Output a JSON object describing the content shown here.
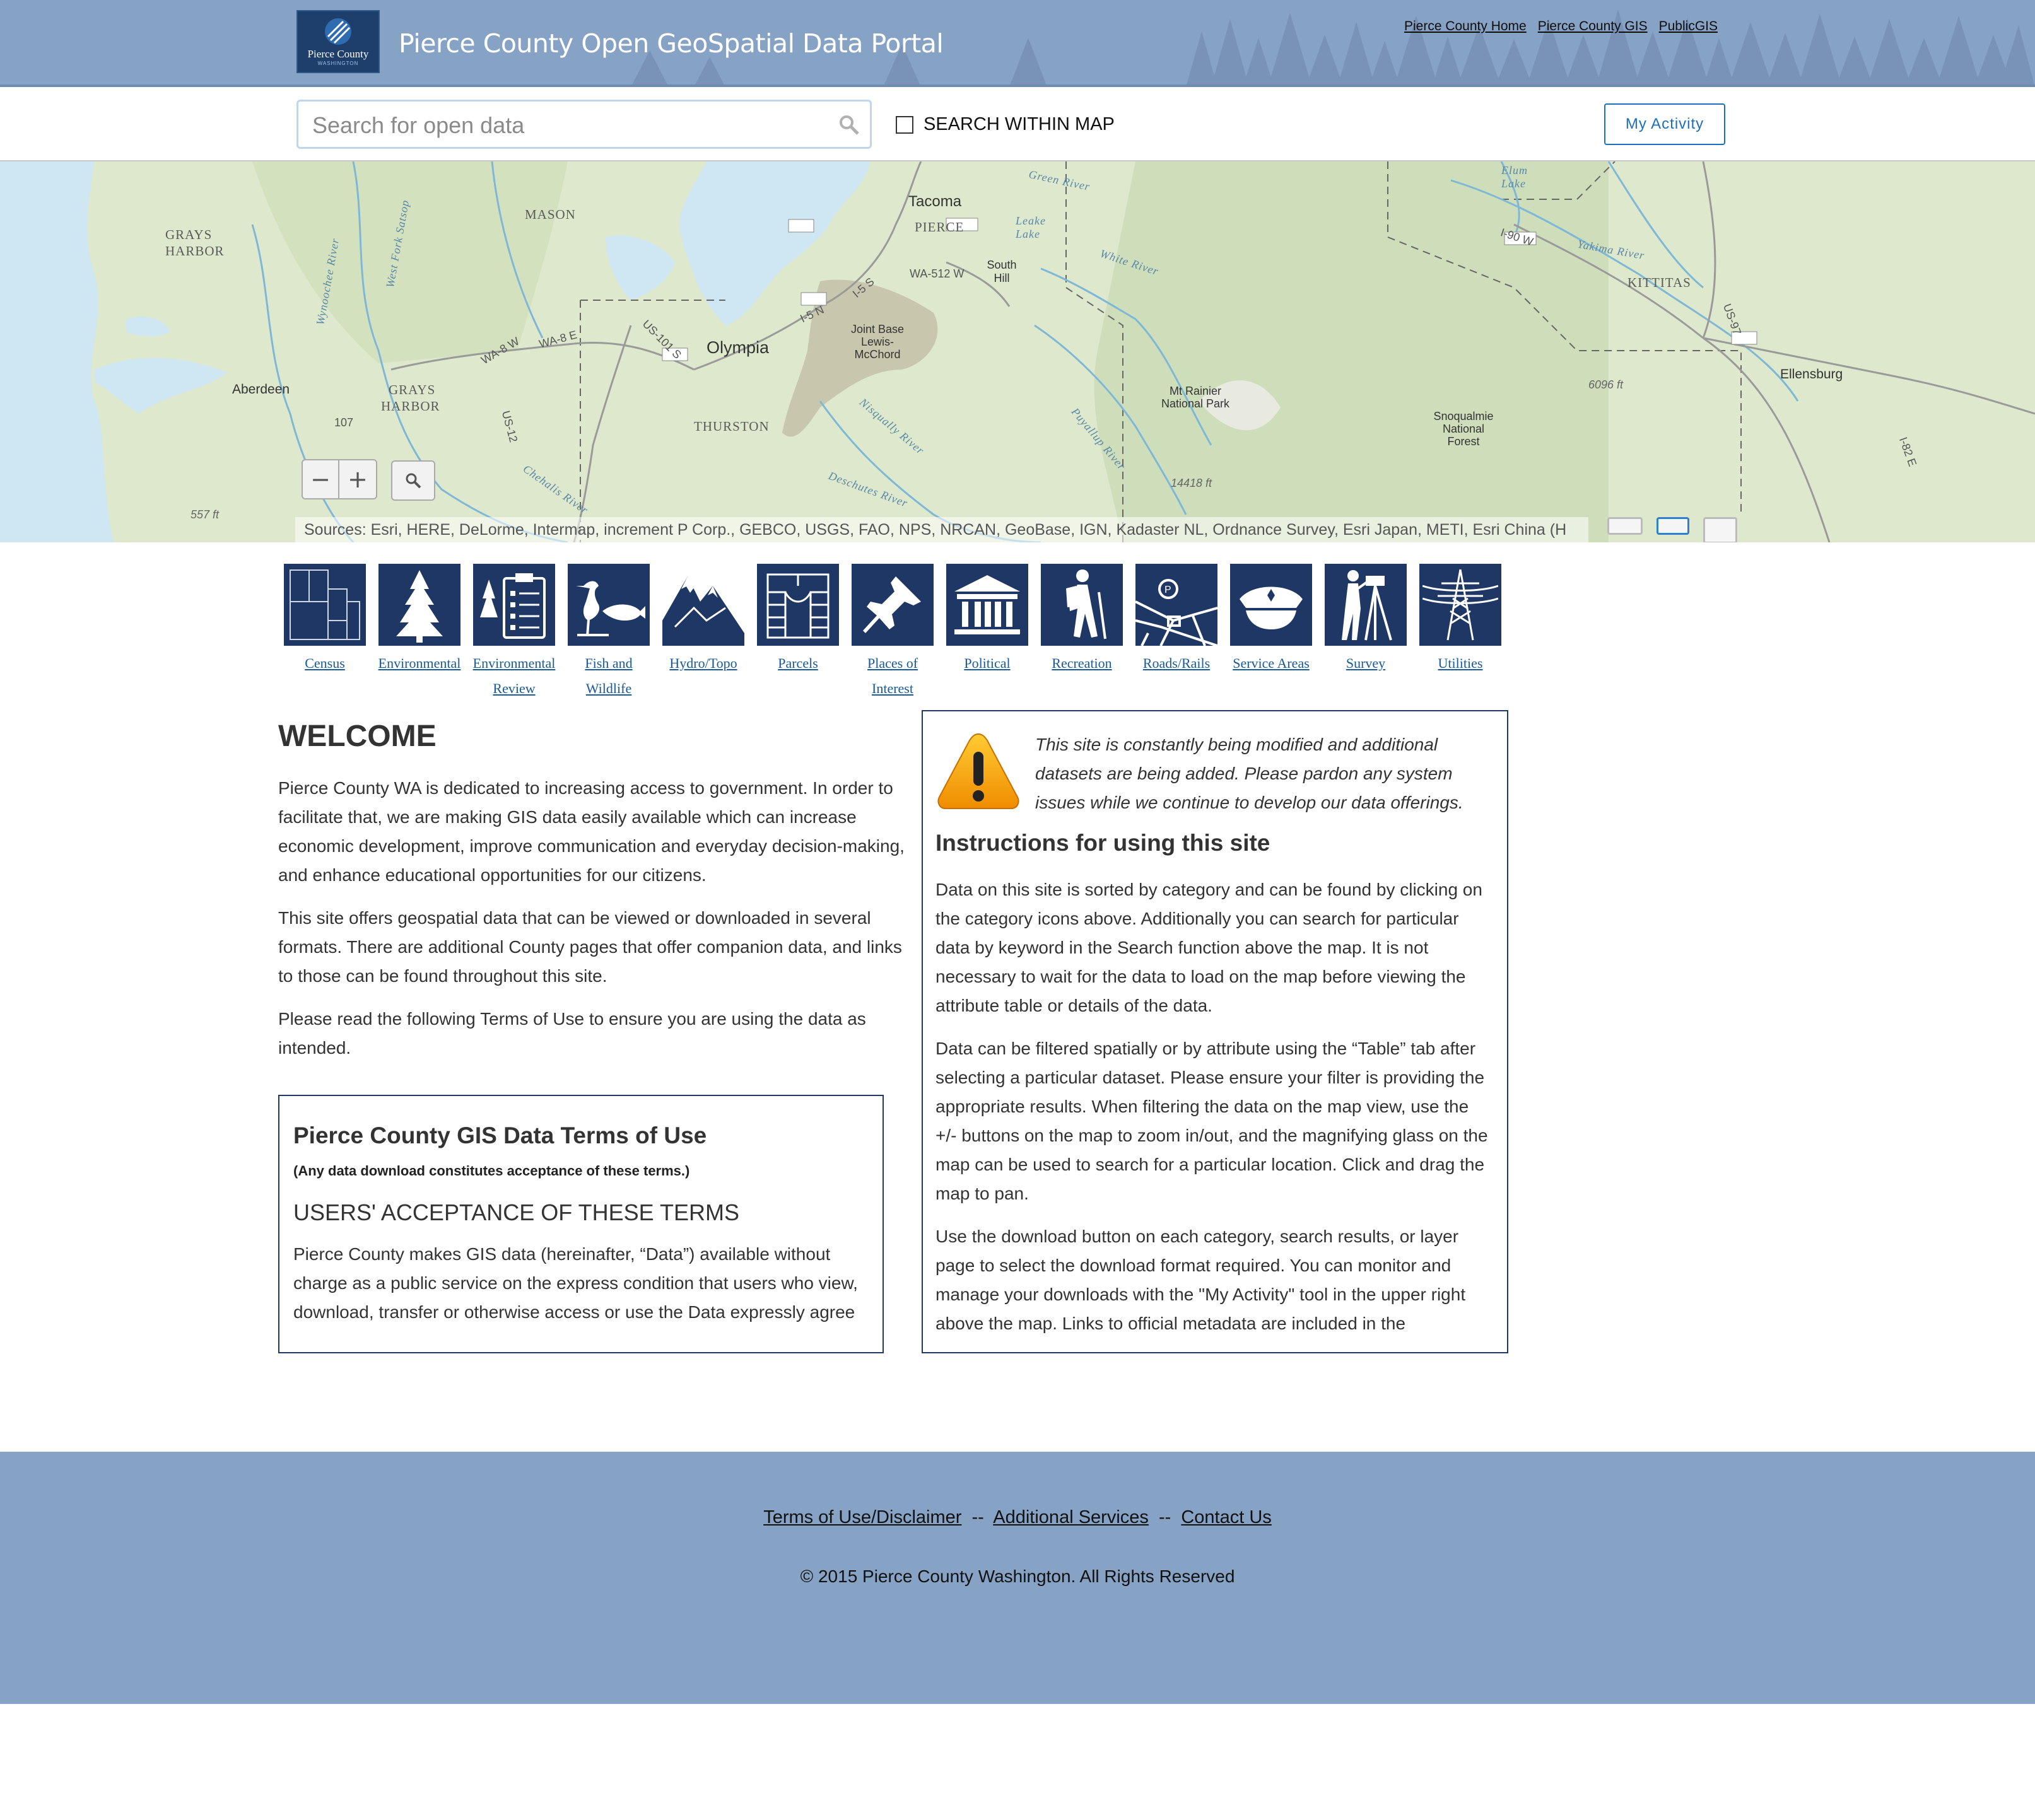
{
  "header": {
    "logo_name": "Pierce County",
    "logo_sub": "WASHINGTON",
    "title": "Pierce County Open GeoSpatial Data Portal",
    "links": [
      "Pierce County Home",
      "Pierce County GIS",
      "PublicGIS"
    ]
  },
  "search": {
    "placeholder": "Search for open data",
    "within_map_label": "SEARCH WITHIN MAP",
    "my_activity_label": "My Activity"
  },
  "map": {
    "labels": {
      "grays_harbor_1a": "GRAYS",
      "grays_harbor_1b": "HARBOR",
      "mason": "MASON",
      "tacoma": "Tacoma",
      "pierce": "PIERCE",
      "green_river": "Green River",
      "lake_leake": "Leake Lake",
      "elum": "Elum Lake",
      "south_hill": "South Hill",
      "wa512": "WA-512 W",
      "i90": "I-90 W",
      "yakima": "Yakima River",
      "kittitas": "KITTITAS",
      "white_river": "White River",
      "olympia": "Olympia",
      "jblm": "Joint Base Lewis-McChord",
      "aberdeen": "Aberdeen",
      "grays_harbor_2a": "GRAYS",
      "grays_harbor_2b": "HARBOR",
      "thurston": "THURSTON",
      "mt_rainier": "Mt Rainier National Park",
      "snoqualmie": "Snoqualmie National Forest",
      "ellensburg": "Ellensburg",
      "elev_6096": "6096 ft",
      "elev_14418": "14418 ft",
      "elev_557": "557 ft",
      "nisqually": "Nisqually River",
      "deschutes": "Deschutes River",
      "puyallup": "Puyallup River",
      "chehalis": "Chehalis River",
      "wynoochee": "Wynoochee River",
      "west_fork": "West Fork Satsop",
      "us101": "US-101 S",
      "i5n": "I-5 N",
      "i5s": "I-5 S",
      "wa8w": "WA-8 W",
      "wa8e": "WA-8 E",
      "us12": "US-12",
      "route107": "107",
      "us97": "US-97",
      "i82": "I-82 E"
    },
    "zoom_out": "−",
    "zoom_in": "+",
    "attribution": "Sources: Esri, HERE, DeLorme, Intermap, increment P Corp., GEBCO, USGS, FAO, NPS, NRCAN, GeoBase, IGN, Kadaster NL, Ordnance Survey, Esri Japan, METI, Esri China (H"
  },
  "categories": [
    {
      "label": "Census",
      "icon": "census-map-icon"
    },
    {
      "label": "Environmental",
      "icon": "tree-icon"
    },
    {
      "label": "Environmental Review",
      "icon": "clipboard-tree-icon"
    },
    {
      "label": "Fish and Wildlife",
      "icon": "heron-fish-icon"
    },
    {
      "label": "Hydro/Topo",
      "icon": "mountain-icon"
    },
    {
      "label": "Parcels",
      "icon": "parcels-icon"
    },
    {
      "label": "Places of Interest",
      "icon": "pushpin-icon"
    },
    {
      "label": "Political",
      "icon": "capitol-icon"
    },
    {
      "label": "Recreation",
      "icon": "hiker-icon"
    },
    {
      "label": "Roads/Rails",
      "icon": "roads-icon"
    },
    {
      "label": "Service Areas",
      "icon": "police-cap-icon"
    },
    {
      "label": "Survey",
      "icon": "surveyor-icon"
    },
    {
      "label": "Utilities",
      "icon": "power-tower-icon"
    }
  ],
  "welcome": {
    "title": "WELCOME",
    "p1": "Pierce County WA is dedicated to increasing access to government. In order to facilitate that, we are making GIS data easily available which can increase economic development, improve communication and everyday decision-making, and enhance educational opportunities for our citizens.",
    "p2": "This site offers geospatial data that can be viewed or downloaded in several formats. There are additional County pages that offer companion data, and links to those can be found throughout this site.",
    "p3": "Please read the following Terms of Use to ensure you are using the data as intended."
  },
  "terms": {
    "title": "Pierce County GIS Data Terms of Use",
    "sub": "(Any data download constitutes acceptance of these terms.)",
    "heading": "USERS' ACCEPTANCE OF THESE TERMS",
    "body": "Pierce County makes GIS data (hereinafter, “Data”) available without charge as a public service on the express condition that users who view, download, transfer or otherwise access or use the Data expressly agree"
  },
  "info": {
    "warning": "This site is constantly being modified and additional datasets are being added. Please pardon any system issues while we continue to develop our data offerings.",
    "title": "Instructions for using this site",
    "p1": "Data on this site is sorted by category and can be found by clicking on the category icons above. Additionally you can search for particular data by keyword in the Search function above the map. It is not necessary to wait for the data to load on the map before viewing the attribute table or details of the data.",
    "p2": "Data can be filtered spatially or by attribute using the “Table” tab after selecting a particular dataset. Please ensure your filter is providing the appropriate results. When filtering the data on the map view, use the +/- buttons on the map to zoom in/out, and the magnifying glass on the map can be used to search for a particular location. Click and drag the map to pan.",
    "p3": "Use the download button on each category, search results, or layer page to select the download format required. You can monitor and manage your downloads with the \"My Activity\" tool in the upper right above the map. Links to official metadata are included in the"
  },
  "footer": {
    "terms_link": "Terms of Use/Disclaimer",
    "sep": "--",
    "services_link": "Additional Services",
    "contact_link": "Contact Us",
    "copyright": "© 2015 Pierce County Washington. All Rights Reserved"
  }
}
